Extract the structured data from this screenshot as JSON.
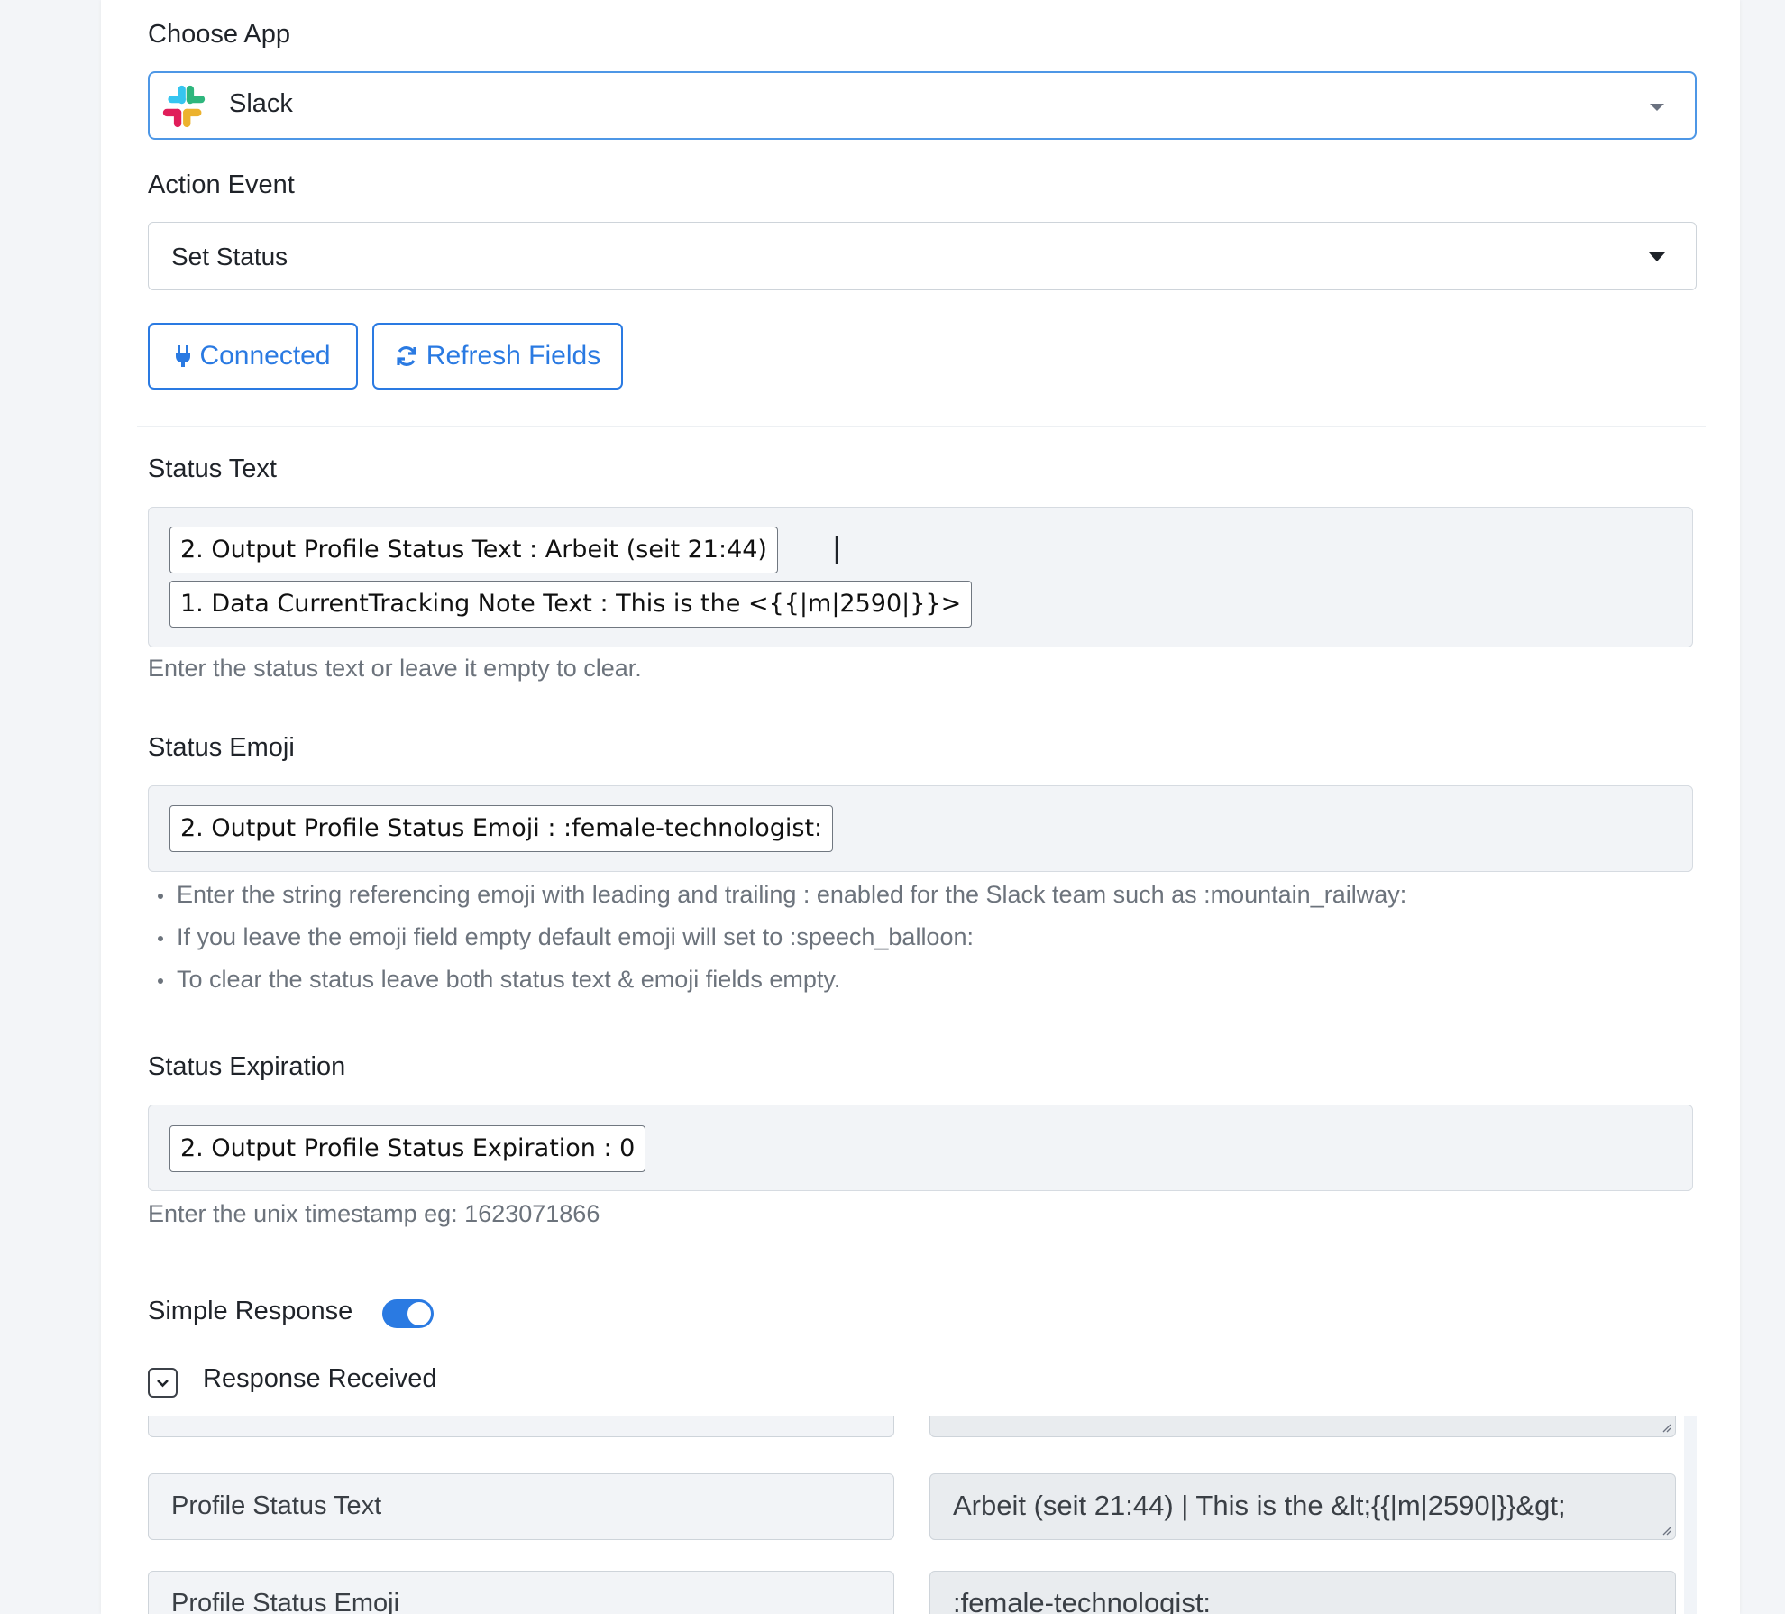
{
  "choose_app": {
    "label": "Choose App",
    "selected": "Slack"
  },
  "action_event": {
    "label": "Action Event",
    "selected": "Set Status"
  },
  "buttons": {
    "connected": "Connected",
    "refresh": "Refresh Fields"
  },
  "status_text": {
    "label": "Status Text",
    "tokens": [
      "2. Output Profile Status Text : Arbeit (seit 21:44)",
      "1. Data CurrentTracking Note Text : This is the <{{|m|2590|}}>"
    ],
    "separator": "|",
    "help": "Enter the status text or leave it empty to clear."
  },
  "status_emoji": {
    "label": "Status Emoji",
    "token": "2. Output Profile Status Emoji : :female-technologist:",
    "help": [
      "Enter the string referencing emoji with leading and trailing : enabled for the Slack team such as :mountain_railway:",
      "If you leave the emoji field empty default emoji will set to :speech_balloon:",
      "To clear the status leave both status text & emoji fields empty."
    ]
  },
  "status_expiration": {
    "label": "Status Expiration",
    "token": "2. Output Profile Status Expiration : 0",
    "help": "Enter the unix timestamp eg: 1623071866"
  },
  "simple_response": {
    "label": "Simple Response",
    "enabled": true
  },
  "response_received": {
    "label": "Response Received",
    "rows": [
      {
        "key": "Profile Status Text",
        "value": "Arbeit (seit 21:44) | This is the &lt;{{|m|2590|}}&gt;"
      },
      {
        "key": "Profile Status Emoji",
        "value": ":female-technologist:"
      }
    ]
  },
  "colors": {
    "accent": "#2a7ae2",
    "focus_border": "#4d97e6",
    "field_bg": "#f2f4f7",
    "help_text": "#6c737c"
  }
}
